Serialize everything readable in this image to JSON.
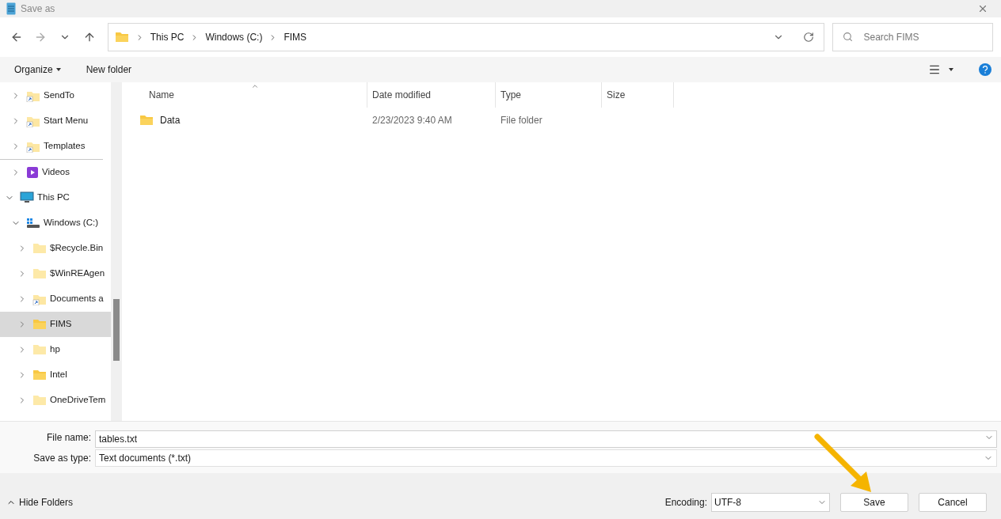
{
  "window": {
    "title": "Save as"
  },
  "address_bar": {
    "crumbs": [
      "This PC",
      "Windows (C:)",
      "FIMS"
    ]
  },
  "search": {
    "placeholder": "Search FIMS"
  },
  "toolbar": {
    "organize": "Organize",
    "new_folder": "New folder"
  },
  "sidebar": {
    "scrolled_branch": [
      {
        "label": "SendTo",
        "kind": "shortcut",
        "expanded": false,
        "selected": false
      },
      {
        "label": "Start Menu",
        "kind": "shortcut",
        "expanded": false,
        "selected": false
      },
      {
        "label": "Templates",
        "kind": "shortcut",
        "expanded": false,
        "selected": false
      },
      {
        "label": "Videos",
        "kind": "video",
        "expanded": false,
        "selected": false
      }
    ],
    "tree": [
      {
        "label": "This PC",
        "kind": "pc",
        "expanded": true,
        "selected": false,
        "children": [
          {
            "label": "Windows (C:)",
            "kind": "drive",
            "expanded": true,
            "selected": false,
            "children": [
              {
                "label": "$Recycle.Bin",
                "kind": "pale",
                "expanded": false,
                "selected": false
              },
              {
                "label": "$WinREAgen",
                "kind": "pale",
                "expanded": false,
                "selected": false
              },
              {
                "label": "Documents a",
                "kind": "shortcut",
                "expanded": false,
                "selected": false
              },
              {
                "label": "FIMS",
                "kind": "folder",
                "expanded": false,
                "selected": true
              },
              {
                "label": "hp",
                "kind": "pale",
                "expanded": false,
                "selected": false
              },
              {
                "label": "Intel",
                "kind": "folder",
                "expanded": false,
                "selected": false
              },
              {
                "label": "OneDriveTem",
                "kind": "pale",
                "expanded": false,
                "selected": false
              }
            ]
          }
        ]
      }
    ]
  },
  "table": {
    "columns": [
      "Name",
      "Date modified",
      "Type",
      "Size"
    ],
    "rows": [
      {
        "name": "Data",
        "date": "2/23/2023 9:40 AM",
        "type": "File folder"
      }
    ]
  },
  "form": {
    "file_name_label": "File name:",
    "file_name": "tables.txt",
    "type_label": "Save as type:",
    "type": "Text documents (*.txt)"
  },
  "footer": {
    "hide_folders": "Hide Folders",
    "encoding_label": "Encoding:",
    "encoding": "UTF-8",
    "save": "Save",
    "cancel": "Cancel"
  }
}
